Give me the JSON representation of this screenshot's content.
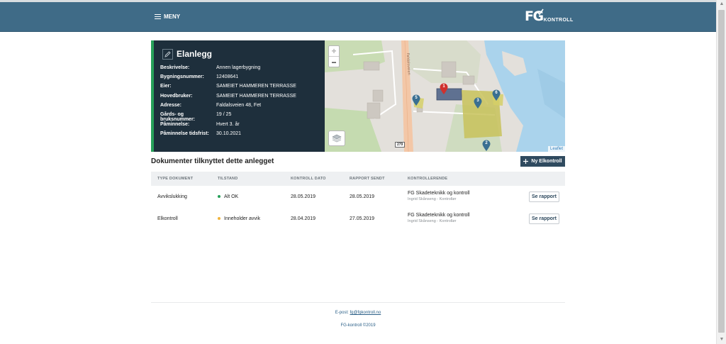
{
  "header": {
    "menu_label": "MENY",
    "logo_text": "FG",
    "logo_subtext": "KONTROLL"
  },
  "panel": {
    "title": "Elanlegg",
    "rows": [
      {
        "label": "Beskrivelse:",
        "value": "Annen lagerbygning"
      },
      {
        "label": "Bygningsnummer:",
        "value": "12408641"
      },
      {
        "label": "Eier:",
        "value": "SAMEIET HAMMEREN TERRASSE"
      },
      {
        "label": "Hovedbruker:",
        "value": "SAMEIET HAMMEREN TERRASSE"
      },
      {
        "label": "Adresse:",
        "value": "Faldalsveien 48, Fet"
      },
      {
        "label": "Gårds- og bruksnummer:",
        "value": "19 / 25"
      },
      {
        "label": "Påminnelse:",
        "value": "Hvert 3. år"
      },
      {
        "label": "Påminnelse tidsfrist:",
        "value": "30.10.2021"
      }
    ]
  },
  "map": {
    "zoom_in": "+",
    "zoom_out": "−",
    "attribution": "Leaflet",
    "road_label": "Faldalsveien",
    "road_number": "279",
    "markers": [
      "1",
      "2",
      "3",
      "5",
      "6"
    ]
  },
  "documents": {
    "title": "Dokumenter tilknyttet dette anlegget",
    "new_button": "Ny Elkontroll",
    "columns": [
      "TYPE DOKUMENT",
      "TILSTAND",
      "KONTROLL DATO",
      "RAPPORT SENDT",
      "KONTROLLERENDE"
    ],
    "rows": [
      {
        "type": "Avvikslukking",
        "status": "Alt OK",
        "status_color": "#27a05a",
        "kontroll_dato": "28.05.2019",
        "rapport_sendt": "28.05.2019",
        "kontrollerende": "FG Skadeteknikk og kontroll",
        "kontrollerende_sub": "Ingrid Skånseng - Kontrollør",
        "button": "Se rapport"
      },
      {
        "type": "Elkontroll",
        "status": "Inneholder avvik",
        "status_color": "#f0b43c",
        "kontroll_dato": "28.04.2019",
        "rapport_sendt": "27.05.2019",
        "kontrollerende": "FG Skadeteknikk og kontroll",
        "kontrollerende_sub": "Ingrid Skånseng - Kontrollør",
        "button": "Se rapport"
      }
    ]
  },
  "footer": {
    "email_label": "E-post:",
    "email": "fg@fgkontroll.no",
    "copyright": "FG-kontroll ©2019"
  },
  "colors": {
    "header": "#3f6b87",
    "panel": "#1e2f3c",
    "accent_green": "#27a05a",
    "button_dark": "#2f4a5f",
    "marker_blue": "#3a6f91",
    "marker_red": "#d0312d"
  },
  "icons": [
    "hamburger-icon",
    "pencil-icon",
    "layers-icon",
    "plus-icon",
    "map-marker-icon"
  ]
}
